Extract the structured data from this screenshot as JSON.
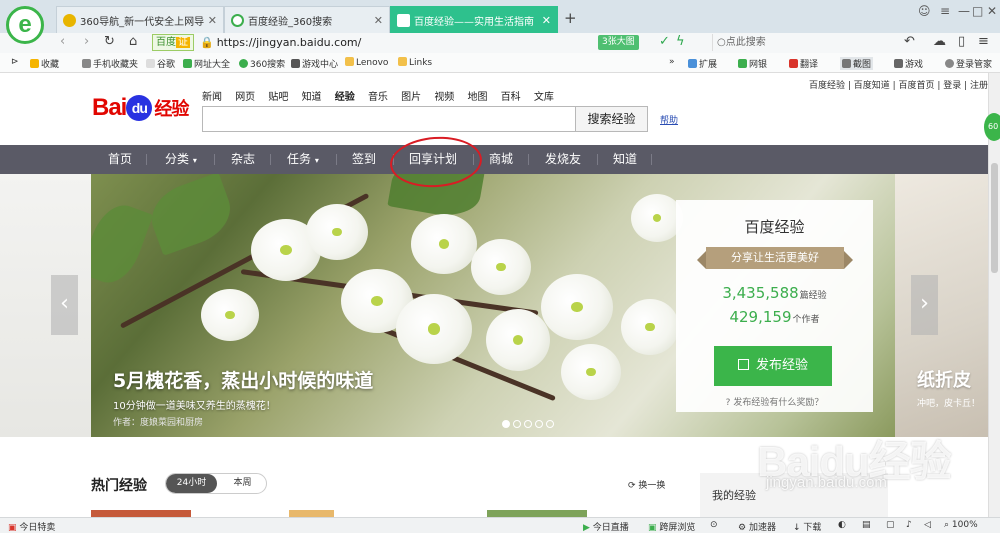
{
  "browser": {
    "tabs": [
      {
        "label": "360导航_新一代安全上网导航",
        "color": "#e8b500"
      },
      {
        "label": "百度经验_360搜索",
        "color": "#3cae4d"
      },
      {
        "label": "百度经验——实用生活指南",
        "color": "#2932e1"
      }
    ],
    "new_tab": "+",
    "address": {
      "safe_badge": "百度",
      "safe_tag": "证",
      "url": "https://jingyan.baidu.com/",
      "speed_label": "3张大图",
      "search_placeholder": "点此搜索"
    },
    "bookmarks": [
      "收藏",
      "手机收藏夹",
      "谷歌",
      "网址大全",
      "360搜索",
      "游戏中心",
      "Lenovo",
      "Links"
    ],
    "toolbar_right": [
      "扩展",
      "网银",
      "翻译",
      "截图",
      "游戏",
      "登录管家"
    ]
  },
  "page": {
    "top_links": "百度经验 | 百度知道 | 百度首页 | 登录 | 注册",
    "logo": {
      "bai": "Bai",
      "du": "du",
      "jy": "经验"
    },
    "search_categories": [
      "新闻",
      "网页",
      "贴吧",
      "知道",
      "经验",
      "音乐",
      "图片",
      "视频",
      "地图",
      "百科",
      "文库"
    ],
    "search_button": "搜索经验",
    "help_link": "帮助",
    "nav": [
      "首页",
      "分类",
      "杂志",
      "任务",
      "签到",
      "回享计划",
      "商城",
      "发烧友",
      "知道"
    ],
    "banner": {
      "title": "5月槐花香，蒸出小时候的味道",
      "subtitle": "10分钟做一道美味又养生的蒸槐花！",
      "author": "作者：度娘菜园和厨房",
      "next_title": "纸折皮",
      "next_sub": "冲吧，皮卡丘！"
    },
    "card": {
      "title": "百度经验",
      "slogan": "分享让生活更美好",
      "count_articles": "3,435,588",
      "unit_articles": "篇经验",
      "count_authors": "429,159",
      "unit_authors": "个作者",
      "publish": "发布经验",
      "reward": "发布经验有什么奖励？"
    },
    "hot": {
      "title": "热门经验",
      "tab_24h": "24小时",
      "tab_week": "本周",
      "refresh": "换一换",
      "my_exp": "我的经验"
    },
    "side_bubble": "60"
  },
  "status": {
    "left": "今日特卖",
    "items": [
      "今日直播",
      "跨屏浏览",
      "加速器",
      "下载",
      "100%"
    ]
  },
  "watermark": {
    "text": "Baidu经验",
    "url": "jingyan.baidu.com"
  }
}
